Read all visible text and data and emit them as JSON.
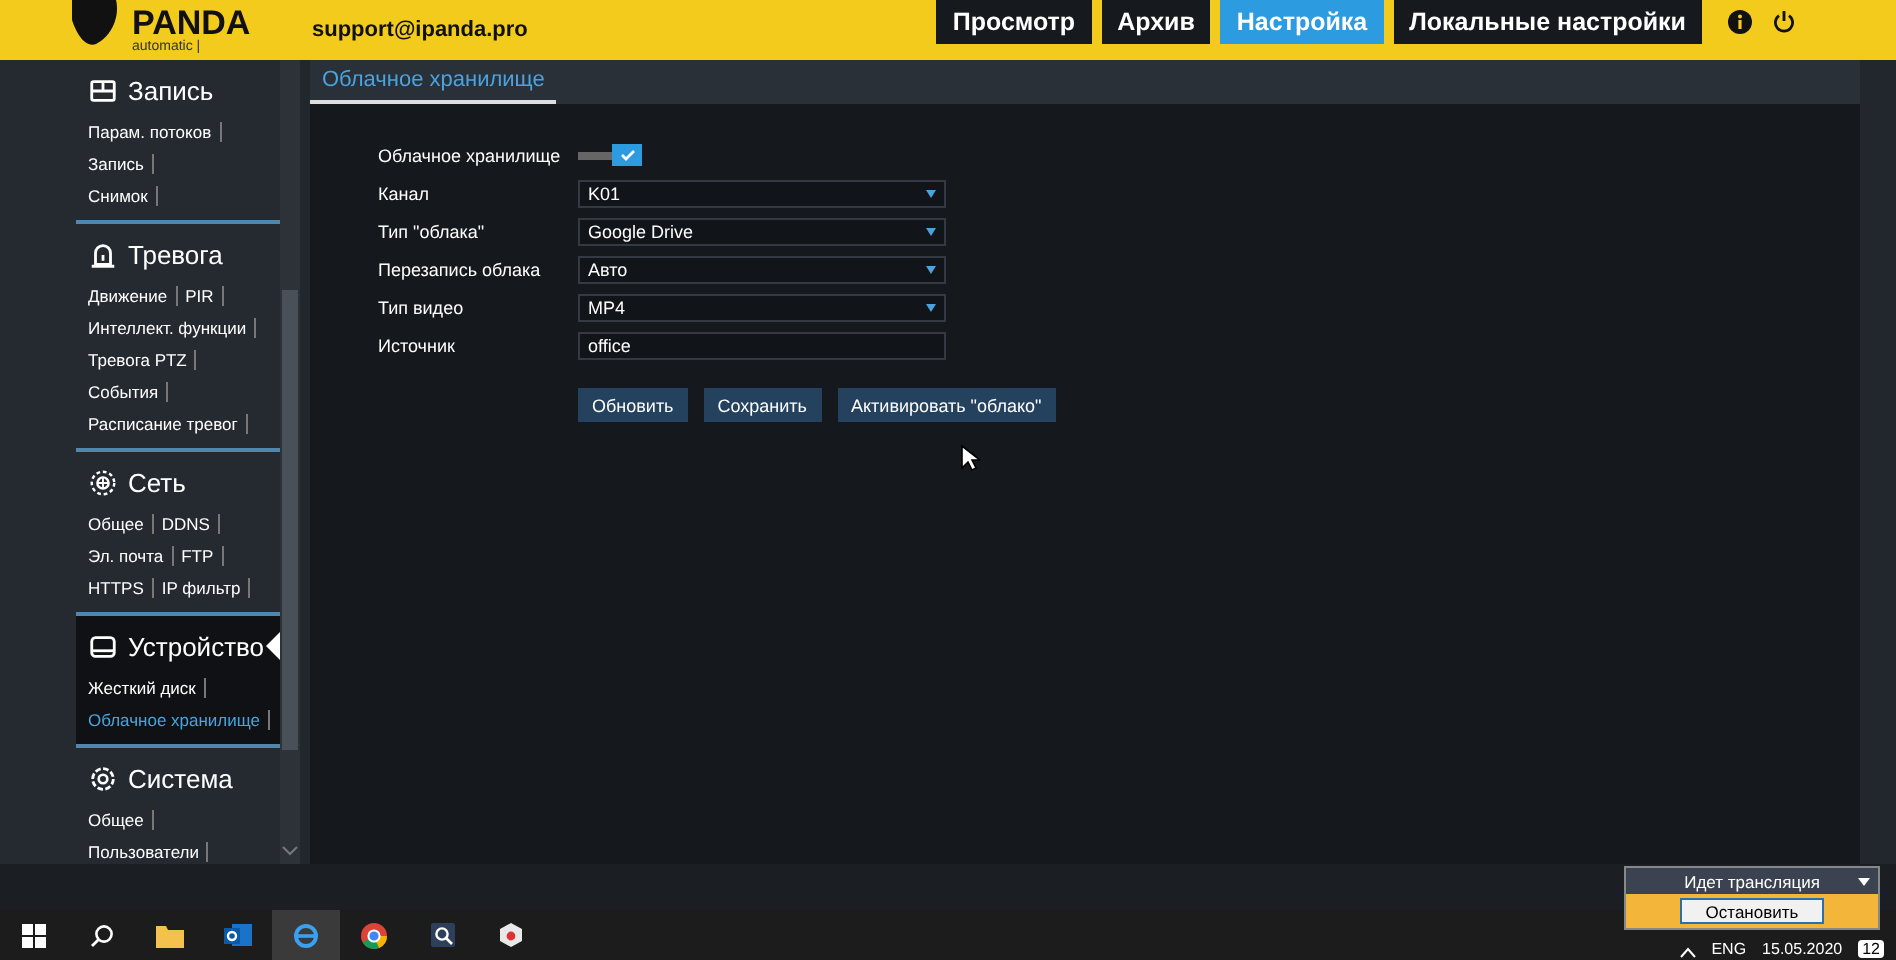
{
  "header": {
    "logo_text": "PANDA",
    "logo_sub": "automatic |",
    "contact": "support@ipanda.pro"
  },
  "nav": [
    {
      "label": "Просмотр",
      "selected": false
    },
    {
      "label": "Архив",
      "selected": false
    },
    {
      "label": "Настройка",
      "selected": true
    },
    {
      "label": "Локальные настройки",
      "selected": false
    }
  ],
  "sidebar": {
    "sections": [
      {
        "title": "Запись",
        "selected": false,
        "rows": [
          [
            {
              "label": "Парам. потоков",
              "selected": false
            }
          ],
          [
            {
              "label": "Запись",
              "selected": false
            }
          ],
          [
            {
              "label": "Снимок",
              "selected": false
            }
          ]
        ]
      },
      {
        "title": "Тревога",
        "selected": false,
        "rows": [
          [
            {
              "label": "Движение",
              "selected": false
            },
            {
              "label": "PIR",
              "selected": false
            }
          ],
          [
            {
              "label": "Интеллект. функции",
              "selected": false
            }
          ],
          [
            {
              "label": "Тревога PTZ",
              "selected": false
            }
          ],
          [
            {
              "label": "События",
              "selected": false
            }
          ],
          [
            {
              "label": "Расписание тревог",
              "selected": false
            }
          ]
        ]
      },
      {
        "title": "Сеть",
        "selected": false,
        "rows": [
          [
            {
              "label": "Общее",
              "selected": false
            },
            {
              "label": "DDNS",
              "selected": false
            }
          ],
          [
            {
              "label": "Эл. почта",
              "selected": false
            },
            {
              "label": "FTP",
              "selected": false
            }
          ],
          [
            {
              "label": "HTTPS",
              "selected": false
            },
            {
              "label": "IP фильтр",
              "selected": false
            }
          ]
        ]
      },
      {
        "title": "Устройство",
        "selected": true,
        "rows": [
          [
            {
              "label": "Жесткий диск",
              "selected": false
            }
          ],
          [
            {
              "label": "Облачное хранилище",
              "selected": true
            }
          ]
        ]
      },
      {
        "title": "Система",
        "selected": false,
        "rows": [
          [
            {
              "label": "Общее",
              "selected": false
            }
          ],
          [
            {
              "label": "Пользователи",
              "selected": false
            }
          ]
        ]
      }
    ]
  },
  "content": {
    "tab": "Облачное хранилище",
    "fields": [
      {
        "kind": "toggle",
        "label": "Облачное хранилище",
        "on": true
      },
      {
        "kind": "select",
        "label": "Канал",
        "value": "K01"
      },
      {
        "kind": "select",
        "label": "Тип \"облака\"",
        "value": "Google Drive"
      },
      {
        "kind": "select",
        "label": "Перезапись облака",
        "value": "Авто"
      },
      {
        "kind": "select",
        "label": "Тип видео",
        "value": "MP4"
      },
      {
        "kind": "text",
        "label": "Источник",
        "value": "office"
      }
    ],
    "buttons": [
      "Обновить",
      "Сохранить",
      "Активировать \"облако\""
    ]
  },
  "stream_popup": {
    "title": "Идет трансляция",
    "button": "Остановить"
  },
  "taskbar": {
    "lang": "ENG",
    "date": "15.05.2020",
    "notifications": "12"
  }
}
